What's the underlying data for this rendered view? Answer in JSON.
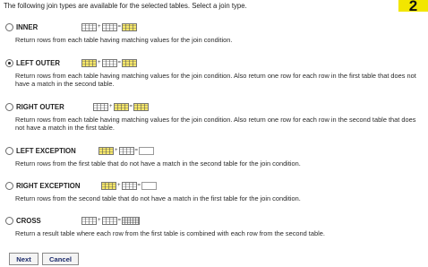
{
  "intro": "The following join types are available for the selected tables. Select a join type.",
  "badge": "2",
  "options": [
    {
      "label": "INNER",
      "selected": false,
      "desc": "Return rows from each table having matching values for the join condition.",
      "diagram": "inner-join"
    },
    {
      "label": "LEFT OUTER",
      "selected": true,
      "desc": "Return rows from each table having matching values for the join condition. Also return one row for each row in the first table that does not have a match in the second table.",
      "diagram": "left-outer-join"
    },
    {
      "label": "RIGHT OUTER",
      "selected": false,
      "desc": "Return rows from each table having matching values for the join condition. Also return one row for each row in the second table that does not have a match in the first table.",
      "diagram": "right-outer-join"
    },
    {
      "label": "LEFT EXCEPTION",
      "selected": false,
      "desc": "Return rows from the first table that do not have a match in the second table for the join condition.",
      "diagram": "left-exception-join"
    },
    {
      "label": "RIGHT EXCEPTION",
      "selected": false,
      "desc": "Return rows from the second table that do not have a match in the first table for the join condition.",
      "diagram": "right-exception-join"
    },
    {
      "label": "CROSS",
      "selected": false,
      "desc": "Return a result table where each row from the first table is combined with each row from the second table.",
      "diagram": "cross-join"
    }
  ],
  "buttons": {
    "next": "Next",
    "cancel": "Cancel"
  },
  "colors": {
    "badge": "#f2e600",
    "highlight": "#f6e76a",
    "button_text": "#1b2a6b"
  }
}
